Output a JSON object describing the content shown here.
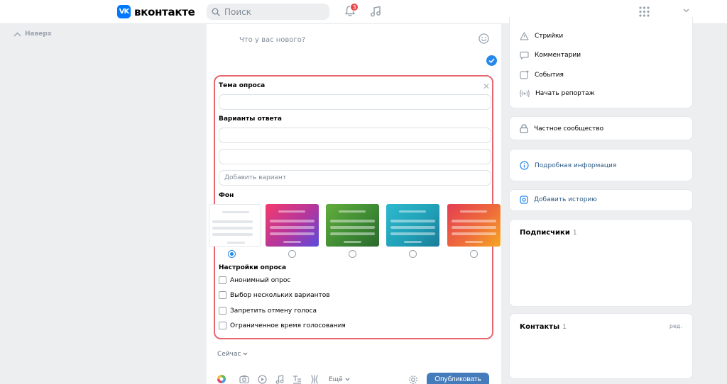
{
  "header": {
    "logo_mark": "VK",
    "logo_text": "вконтакте",
    "search_placeholder": "Поиск",
    "notif_count": "3"
  },
  "left": {
    "scroll_up": "Наверх"
  },
  "composer": {
    "placeholder": "Что у вас нового?",
    "poll": {
      "topic_label": "Тема опроса",
      "answers_label": "Варианты ответа",
      "add_option": "Добавить вариант",
      "bg_label": "Фон",
      "backgrounds": [
        "white",
        "pink-purple",
        "green",
        "teal",
        "red-orange"
      ],
      "selected_background": 0,
      "settings_label": "Настройки опроса",
      "options": [
        {
          "label": "Анонимный опрос",
          "checked": false
        },
        {
          "label": "Выбор нескольких вариантов",
          "checked": false
        },
        {
          "label": "Запретить отмену голоса",
          "checked": false
        },
        {
          "label": "Ограниченное время голосования",
          "checked": false
        }
      ]
    },
    "time": "Сейчас",
    "more": "Ещё",
    "publish": "Опубликовать"
  },
  "right": {
    "menu": [
      "Стрийки",
      "Комментарии",
      "События",
      "Начать репортаж"
    ],
    "private": "Частное сообщество",
    "details": "Подробная информация",
    "add_story": "Добавить историю",
    "subscribers": {
      "title": "Подписчики",
      "count": "1"
    },
    "contacts": {
      "title": "Контакты",
      "count": "1",
      "edit": "ред."
    }
  },
  "colors": {
    "accent": "#2688eb",
    "publish": "#447bba",
    "poll_border": "#e8666f",
    "badge": "#e64646"
  }
}
